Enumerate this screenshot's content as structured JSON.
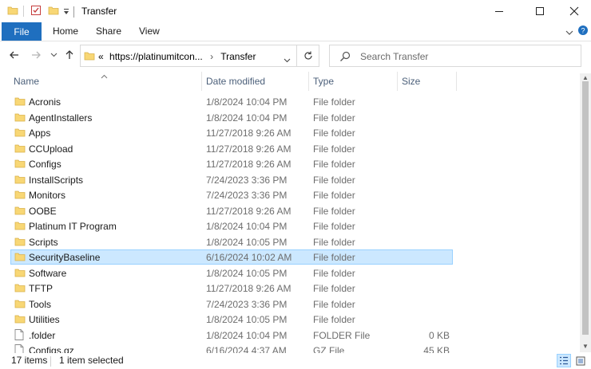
{
  "window": {
    "title": "Transfer"
  },
  "ribbon": {
    "tabs": [
      {
        "label": "File",
        "active": true
      },
      {
        "label": "Home"
      },
      {
        "label": "Share"
      },
      {
        "label": "View"
      }
    ]
  },
  "address": {
    "overflow_marker": "«",
    "segments": [
      "https://platinumitcon...",
      "Transfer"
    ]
  },
  "search": {
    "placeholder": "Search Transfer"
  },
  "columns": {
    "name": "Name",
    "date": "Date modified",
    "type": "Type",
    "size": "Size"
  },
  "files": [
    {
      "name": "Acronis",
      "date": "1/8/2024 10:04 PM",
      "type": "File folder",
      "size": "",
      "icon": "folder-icon"
    },
    {
      "name": "AgentInstallers",
      "date": "1/8/2024 10:04 PM",
      "type": "File folder",
      "size": "",
      "icon": "folder-icon"
    },
    {
      "name": "Apps",
      "date": "11/27/2018 9:26 AM",
      "type": "File folder",
      "size": "",
      "icon": "folder-icon"
    },
    {
      "name": "CCUpload",
      "date": "11/27/2018 9:26 AM",
      "type": "File folder",
      "size": "",
      "icon": "folder-icon"
    },
    {
      "name": "Configs",
      "date": "11/27/2018 9:26 AM",
      "type": "File folder",
      "size": "",
      "icon": "folder-icon"
    },
    {
      "name": "InstallScripts",
      "date": "7/24/2023 3:36 PM",
      "type": "File folder",
      "size": "",
      "icon": "folder-icon"
    },
    {
      "name": "Monitors",
      "date": "7/24/2023 3:36 PM",
      "type": "File folder",
      "size": "",
      "icon": "folder-icon"
    },
    {
      "name": "OOBE",
      "date": "11/27/2018 9:26 AM",
      "type": "File folder",
      "size": "",
      "icon": "folder-icon"
    },
    {
      "name": "Platinum IT Program",
      "date": "1/8/2024 10:04 PM",
      "type": "File folder",
      "size": "",
      "icon": "folder-icon"
    },
    {
      "name": "Scripts",
      "date": "1/8/2024 10:05 PM",
      "type": "File folder",
      "size": "",
      "icon": "folder-icon"
    },
    {
      "name": "SecurityBaseline",
      "date": "6/16/2024 10:02 AM",
      "type": "File folder",
      "size": "",
      "icon": "folder-icon",
      "selected": true
    },
    {
      "name": "Software",
      "date": "1/8/2024 10:05 PM",
      "type": "File folder",
      "size": "",
      "icon": "folder-icon"
    },
    {
      "name": "TFTP",
      "date": "11/27/2018 9:26 AM",
      "type": "File folder",
      "size": "",
      "icon": "folder-icon"
    },
    {
      "name": "Tools",
      "date": "7/24/2023 3:36 PM",
      "type": "File folder",
      "size": "",
      "icon": "folder-icon"
    },
    {
      "name": "Utilities",
      "date": "1/8/2024 10:05 PM",
      "type": "File folder",
      "size": "",
      "icon": "folder-icon"
    },
    {
      "name": ".folder",
      "date": "1/8/2024 10:04 PM",
      "type": "FOLDER File",
      "size": "0 KB",
      "icon": "file-icon"
    },
    {
      "name": "Configs.gz",
      "date": "6/16/2024 4:37 AM",
      "type": "GZ File",
      "size": "45 KB",
      "icon": "file-icon"
    }
  ],
  "status": {
    "item_count": "17 items",
    "selection": "1 item selected"
  },
  "colors": {
    "accent": "#1f6fbf",
    "folder": "#f8d775",
    "selection_bg": "#cce8ff",
    "selection_border": "#99d1ff"
  }
}
